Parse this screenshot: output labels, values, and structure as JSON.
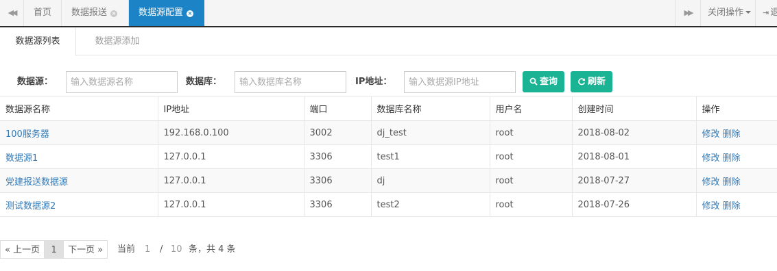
{
  "topbar": {
    "prev_icon": "double-left-arrow-icon",
    "tabs": [
      {
        "label": "首页",
        "closable": false,
        "active": false
      },
      {
        "label": "数据报送",
        "closable": true,
        "active": false
      },
      {
        "label": "数据源配置",
        "closable": true,
        "active": true
      }
    ],
    "next_icon": "double-right-arrow-icon",
    "close_ops_label": "关闭操作",
    "exit_label": "退"
  },
  "subtabs": {
    "list_label": "数据源列表",
    "add_label": "数据源添加"
  },
  "filter": {
    "source_label": "数据源：",
    "source_placeholder": "输入数据源名称",
    "db_label": "数据库：",
    "db_placeholder": "输入数据库名称",
    "ip_label": "IP地址：",
    "ip_placeholder": "输入数据源IP地址",
    "query_label": "查询",
    "refresh_label": "刷新"
  },
  "table": {
    "headers": [
      "数据源名称",
      "IP地址",
      "端口",
      "数据库名称",
      "用户名",
      "创建时间",
      "操作"
    ],
    "rows": [
      {
        "name": "100服务器",
        "ip": "192.168.0.100",
        "port": "3002",
        "db": "dj_test",
        "user": "root",
        "date": "2018-08-02",
        "edit": "修改",
        "del": "删除"
      },
      {
        "name": "数据源1",
        "ip": "127.0.0.1",
        "port": "3306",
        "db": "test1",
        "user": "root",
        "date": "2018-08-01",
        "edit": "修改",
        "del": "删除"
      },
      {
        "name": "党建报送数据源",
        "ip": "127.0.0.1",
        "port": "3306",
        "db": "dj",
        "user": "root",
        "date": "2018-07-27",
        "edit": "修改",
        "del": "删除"
      },
      {
        "name": "测试数据源2",
        "ip": "127.0.0.1",
        "port": "3306",
        "db": "test2",
        "user": "root",
        "date": "2018-07-26",
        "edit": "修改",
        "del": "删除"
      }
    ]
  },
  "pager": {
    "prev_label": "« 上一页",
    "current_page": "1",
    "next_label": "下一页 »",
    "info_prefix": "当前",
    "page": "1",
    "sep": "/",
    "total_pages": "10",
    "info_suffix": "条，共 4 条"
  },
  "colors": {
    "active_tab": "#1c84c6",
    "button": "#1ab394",
    "link": "#337ab7"
  }
}
